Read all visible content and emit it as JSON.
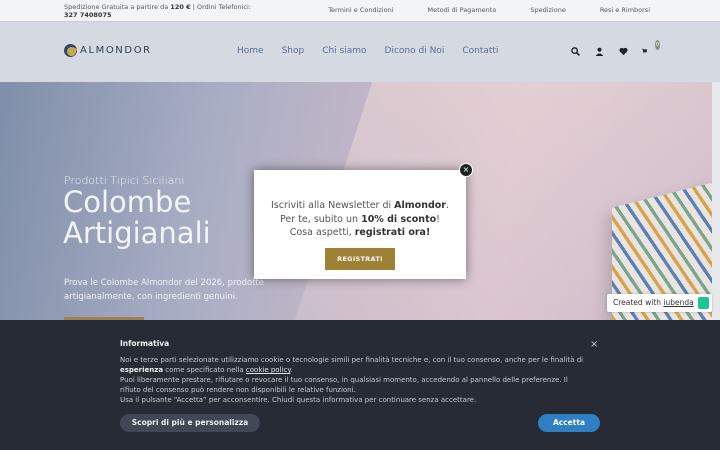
{
  "topbar": {
    "shipping_prefix": "Spedizione Gratuita a partire da ",
    "shipping_amount": "120 €",
    "shipping_suffix": " | Ordini Telefonici: ",
    "phone": "327 7408075",
    "links": [
      "Termini e Condizioni",
      "Metodi di Pagamento",
      "Spedizione",
      "Resi e Rimborsi"
    ]
  },
  "header": {
    "logo_text": "ALMONDOR",
    "nav": [
      "Home",
      "Shop",
      "Chi siamo",
      "Dicono di Noi",
      "Contatti"
    ],
    "cart_count": "0"
  },
  "hero": {
    "subtitle": "Prodotti Tipici Siciliani",
    "title": "Colombe Artigianali",
    "description": "Prova le Colombe Almondor del 2026, prodotte artigianalmente, con ingredienti genuini."
  },
  "modal": {
    "line1_prefix": "Iscriviti alla Newsletter di ",
    "line1_brand": "Almondor",
    "line1_suffix": ".",
    "line2_prefix": "Per te, subito un ",
    "line2_discount": "10% di sconto",
    "line2_suffix": "!",
    "line3_prefix": "Cosa aspetti, ",
    "line3_cta": "registrati ora!",
    "button": "REGISTRATI",
    "close": "×"
  },
  "iubenda": {
    "prefix": "Created with ",
    "link": "iubenda"
  },
  "cookie": {
    "title": "Informativa",
    "p1_a": "Noi e terze parti selezionate utilizziamo cookie o tecnologie simili per finalità tecniche e, con il tuo consenso, anche per le finalità di ",
    "p1_b": "esperienza",
    "p1_c": " come specificato nella ",
    "p1_link": "cookie policy",
    "p1_d": ".",
    "p2": "Puoi liberamente prestare, rifiutare o revocare il tuo consenso, in qualsiasi momento, accedendo al pannello delle preferenze. Il rifiuto del consenso può rendere non disponibili le relative funzioni.",
    "p3": "Usa il pulsante “Accetta” per acconsentire. Chiudi questa informativa per continuare senza accettare.",
    "close": "×",
    "more_button": "Scopri di più e personalizza",
    "accept_button": "Accetta"
  }
}
